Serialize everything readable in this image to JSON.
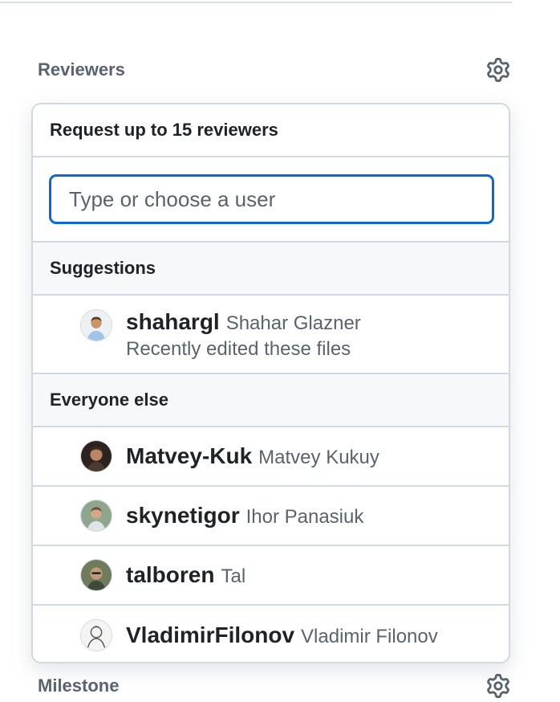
{
  "reviewers": {
    "title": "Reviewers",
    "popover": {
      "header": "Request up to 15 reviewers",
      "filter": {
        "placeholder": "Type or choose a user",
        "value": ""
      },
      "suggestions": {
        "label": "Suggestions",
        "items": [
          {
            "login": "shahargl",
            "name": "Shahar Glazner",
            "description": "Recently edited these files"
          }
        ]
      },
      "everyone": {
        "label": "Everyone else",
        "items": [
          {
            "login": "Matvey-Kuk",
            "name": "Matvey Kukuy"
          },
          {
            "login": "skynetigor",
            "name": "Ihor Panasiuk"
          },
          {
            "login": "talboren",
            "name": "Tal"
          },
          {
            "login": "VladimirFilonov",
            "name": "Vladimir Filonov"
          }
        ]
      }
    }
  },
  "milestone": {
    "title": "Milestone"
  },
  "icons": {
    "gear": "gear-icon",
    "avatar": "user-avatar"
  },
  "colors": {
    "accent": "#0969da",
    "border": "#d1d9e0",
    "muted": "#59636e",
    "text": "#1f2328"
  }
}
